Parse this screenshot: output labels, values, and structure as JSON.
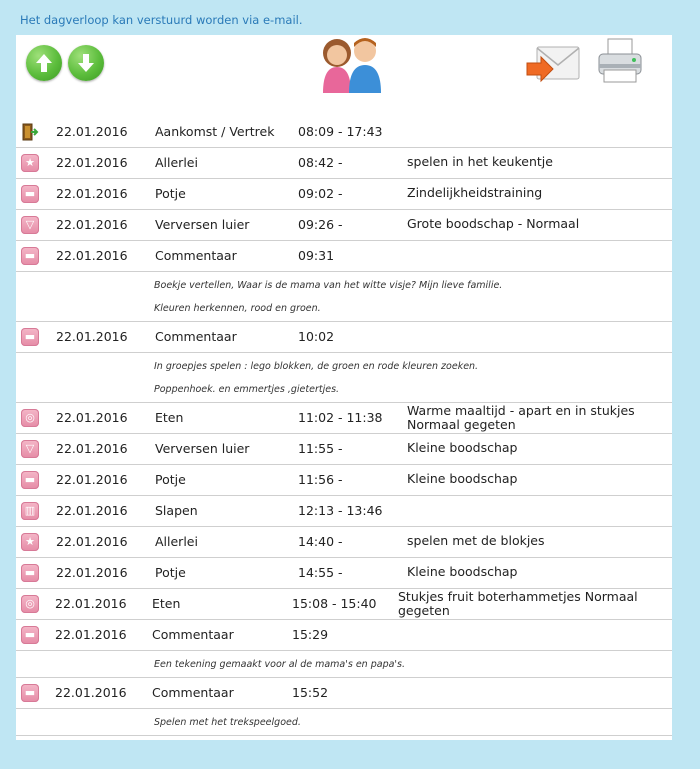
{
  "header": {
    "email_note": "Het dagverloop kan verstuurd worden via e-mail."
  },
  "toolbar": {
    "up_icon": "arrow-up-icon",
    "down_icon": "arrow-down-icon",
    "people_icon": "parents-icon",
    "mail_icon": "send-mail-icon",
    "print_icon": "printer-icon"
  },
  "colors": {
    "background": "#bfe6f3",
    "note_text": "#2a7ab8",
    "icon_pink": "#e58ba6",
    "button_green": "#5cbd3c"
  },
  "entries": [
    {
      "icon": "door-exit-icon",
      "glyph": "",
      "date": "22.01.2016",
      "type": "Aankomst / Vertrek",
      "time": "08:09 - 17:43",
      "detail": ""
    },
    {
      "icon": "star-icon",
      "glyph": "★",
      "date": "22.01.2016",
      "type": "Allerlei",
      "time": "08:42 -",
      "detail": "spelen in het keukentje"
    },
    {
      "icon": "potty-icon",
      "glyph": "▬",
      "date": "22.01.2016",
      "type": "Potje",
      "time": "09:02 -",
      "detail": "Zindelijkheidstraining"
    },
    {
      "icon": "diaper-icon",
      "glyph": "▽",
      "date": "22.01.2016",
      "type": "Verversen luier",
      "time": "09:26 -",
      "detail": "Grote boodschap - Normaal"
    },
    {
      "icon": "comment-icon",
      "glyph": "▬",
      "date": "22.01.2016",
      "type": "Commentaar",
      "time": "09:31",
      "detail": "",
      "comment": [
        "Boekje vertellen, Waar is de mama van het witte visje? Mijn lieve familie.",
        "Kleuren herkennen, rood en groen."
      ]
    },
    {
      "icon": "comment-icon",
      "glyph": "▬",
      "date": "22.01.2016",
      "type": "Commentaar",
      "time": "10:02",
      "detail": "",
      "comment": [
        "In groepjes spelen : lego blokken, de groen en rode kleuren zoeken.",
        "Poppenhoek. en  emmertjes ,gietertjes."
      ]
    },
    {
      "icon": "meal-icon",
      "glyph": "◎",
      "date": "22.01.2016",
      "type": "Eten",
      "time": "11:02 - 11:38",
      "detail": "Warme maaltijd - apart en in stukjes Normaal gegeten"
    },
    {
      "icon": "diaper-icon",
      "glyph": "▽",
      "date": "22.01.2016",
      "type": "Verversen luier",
      "time": "11:55 -",
      "detail": "Kleine boodschap"
    },
    {
      "icon": "potty-icon",
      "glyph": "▬",
      "date": "22.01.2016",
      "type": "Potje",
      "time": "11:56 -",
      "detail": "Kleine boodschap"
    },
    {
      "icon": "bed-icon",
      "glyph": "▥",
      "date": "22.01.2016",
      "type": "Slapen",
      "time": "12:13 - 13:46",
      "detail": ""
    },
    {
      "icon": "star-icon",
      "glyph": "★",
      "date": "22.01.2016",
      "type": "Allerlei",
      "time": "14:40 -",
      "detail": "spelen met de blokjes"
    },
    {
      "icon": "potty-icon",
      "glyph": "▬",
      "date": "22.01.2016",
      "type": "Potje",
      "time": "14:55 -",
      "detail": "Kleine boodschap"
    },
    {
      "icon": "meal-icon",
      "glyph": "◎",
      "date": "22.01.2016",
      "type": "Eten",
      "time": "15:08 - 15:40",
      "detail": "Stukjes fruit boterhammetjes Normaal gegeten"
    },
    {
      "icon": "comment-icon",
      "glyph": "▬",
      "date": "22.01.2016",
      "type": "Commentaar",
      "time": "15:29",
      "detail": "",
      "comment": [
        "Een tekening gemaakt voor al de mama's en papa's."
      ]
    },
    {
      "icon": "comment-icon",
      "glyph": "▬",
      "date": "22.01.2016",
      "type": "Commentaar",
      "time": "15:52",
      "detail": "",
      "comment": [
        "Spelen met het trekspeelgoed."
      ]
    }
  ]
}
